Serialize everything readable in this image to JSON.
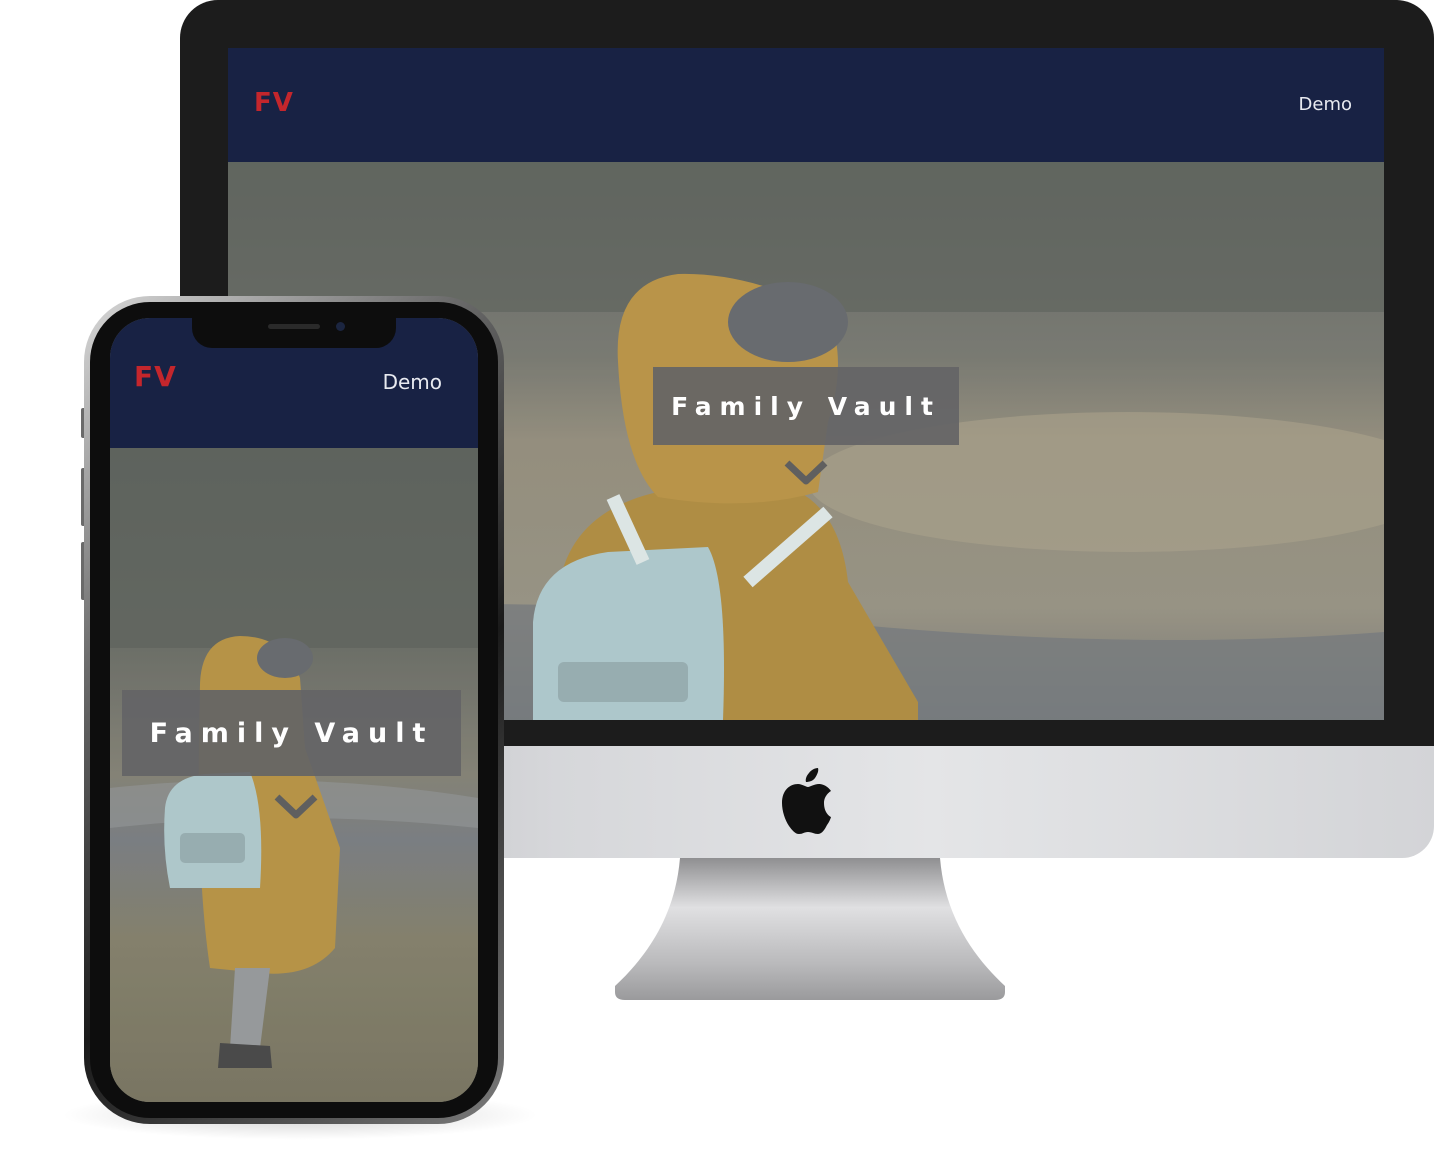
{
  "site": {
    "logo_text": "FV",
    "nav_demo": "Demo",
    "hero_title": "Family Vault"
  },
  "colors": {
    "navbar_bg": "#182244",
    "logo": "#c4262c",
    "hero_box": "#646466"
  },
  "icons": {
    "scroll_down": "chevron-down-icon",
    "device_brand": "apple-logo-icon"
  }
}
